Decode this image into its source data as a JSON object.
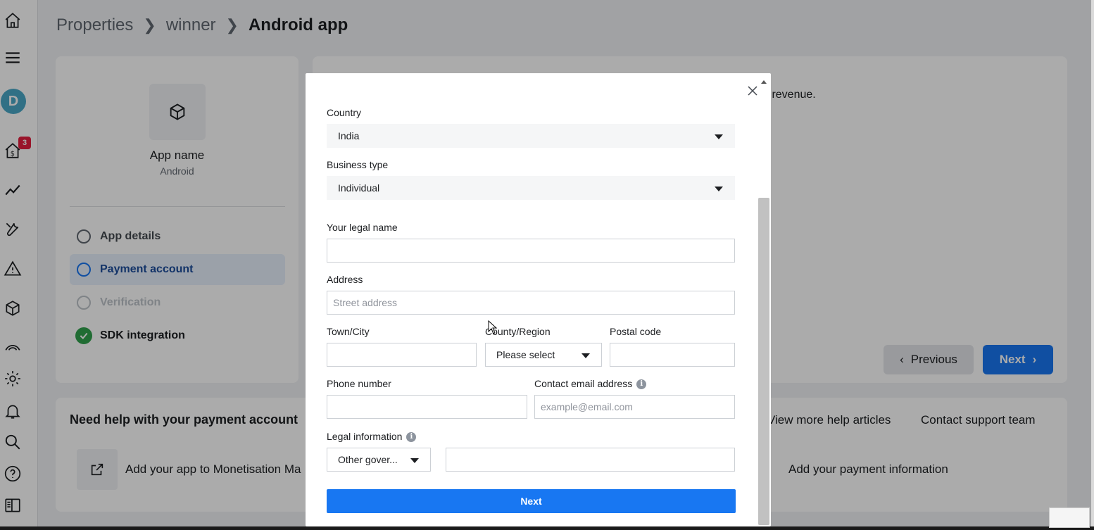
{
  "sidebar": {
    "avatar_letter": "D",
    "notification_count": "3",
    "icons": [
      "home-icon",
      "menu-icon",
      "monetization-icon",
      "trend-icon",
      "tools-icon",
      "warning-icon",
      "cube-icon",
      "network-icon",
      "gear-icon",
      "bell-icon",
      "search-icon",
      "help-icon",
      "panel-icon"
    ]
  },
  "breadcrumb": {
    "items": [
      "Properties",
      "winner",
      "Android app"
    ]
  },
  "left_card": {
    "app_name": "App name",
    "platform": "Android",
    "steps": [
      {
        "label": "App details",
        "state": "pending"
      },
      {
        "label": "Payment account",
        "state": "active"
      },
      {
        "label": "Verification",
        "state": "disabled"
      },
      {
        "label": "SDK integration",
        "state": "done"
      }
    ]
  },
  "right_card": {
    "text_fragment": "k revenue.",
    "previous_label": "Previous",
    "next_label": "Next"
  },
  "help": {
    "title": "Need help with your payment account",
    "view_more": "View more help articles",
    "contact": "Contact support team",
    "item1": "Add your app to Monetisation Ma",
    "item2": "Add your payment information"
  },
  "modal": {
    "country_label": "Country",
    "country_value": "India",
    "business_type_label": "Business type",
    "business_type_value": "Individual",
    "legal_name_label": "Your legal name",
    "legal_name_value": "",
    "address_label": "Address",
    "address_placeholder": "Street address",
    "town_label": "Town/City",
    "county_label": "County/Region",
    "county_value": "Please select",
    "postal_label": "Postal code",
    "phone_label": "Phone number",
    "email_label": "Contact email address",
    "email_placeholder": "example@email.com",
    "legal_info_label": "Legal information",
    "legal_info_value": "Other gover...",
    "next_label": "Next"
  },
  "colors": {
    "primary": "#1877f2",
    "success": "#31a24c",
    "badge": "#e41e3f",
    "avatar": "#4aa8c7"
  }
}
